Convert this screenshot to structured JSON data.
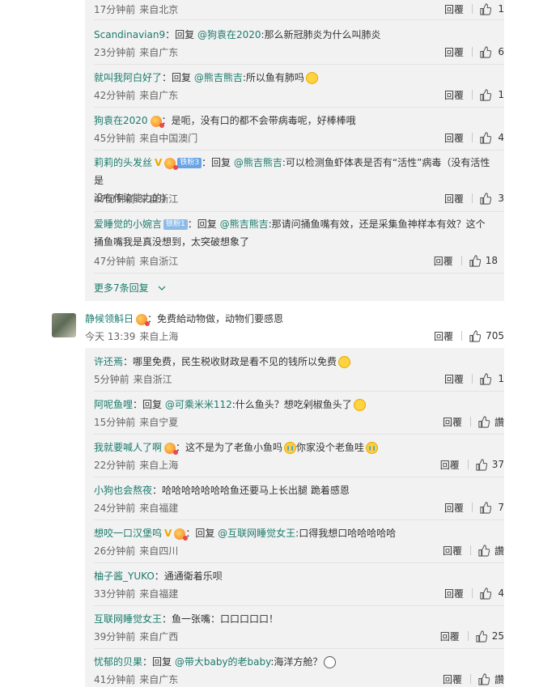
{
  "ui": {
    "reply_label": "回覆",
    "like_icon": "thumbs-up-icon",
    "more_replies": "更多7条回复"
  },
  "top_meta": {
    "time": "17分钟前",
    "location": "来自北京",
    "likes": "1"
  },
  "replies_a": [
    {
      "name": "Scandinavian9",
      "prefix": "：回复 ",
      "at": "@狗袁在2020",
      "text": ":那么新冠肺炎为什么叫肺炎",
      "time": "23分钟前",
      "location": "来自广东",
      "likes": "6"
    },
    {
      "name": "就叫我阿白好了",
      "prefix": "：回复 ",
      "at": "@熊吉熊吉",
      "text": ":所以鱼有肺吗",
      "time": "42分钟前",
      "location": "来自广东",
      "likes": "1"
    },
    {
      "name": "狗袁在2020",
      "prefix": "：",
      "at": "",
      "text": "是呃，没有口的都不会带病毒呢，好棒棒哦",
      "time": "45分钟前",
      "location": "来自中国澳门",
      "likes": "4"
    },
    {
      "name": "莉莉的头发丝",
      "fans_badge": "铁粉3",
      "prefix": "：回复 ",
      "at": "@熊吉熊吉",
      "text": ":可以检测鱼虾体表是否有“活性”病毒（没有活性是",
      "text2": "没有传染能力的）",
      "time": "47分钟前",
      "location": "来自浙江",
      "likes": "3"
    },
    {
      "name": "爱睡觉的小婉言",
      "fans_badge": "铁粉1",
      "prefix": "：回复 ",
      "at": "@熊吉熊吉",
      "text": ":那请问捅鱼嘴有效，还是采集鱼神样本有效？这个",
      "text2": "捅鱼嘴我是真没想到，太突破想象了",
      "time": "47分钟前",
      "location": "来自浙江",
      "likes": "18"
    }
  ],
  "main_comment": {
    "name": "静候领斛日",
    "text": "：免费給动物做，动物们要感恩",
    "time": "今天 13:39",
    "location": "来自上海",
    "likes": "705"
  },
  "replies_b": [
    {
      "name": "许还焉",
      "prefix": "：",
      "at": "",
      "text": "哪里免费，民生税收财政是看不见的钱所以免费",
      "time": "5分钟前",
      "location": "来自浙江",
      "likes": "1"
    },
    {
      "name": "阿呢鱼哩",
      "prefix": "：回复 ",
      "at": "@可乘米米112",
      "text": ":什么鱼头？想吃剁椒鱼头了",
      "time": "15分钟前",
      "location": "来自宁夏",
      "likes": "讚"
    },
    {
      "name": "我就要喊人了啊",
      "prefix": "：",
      "at": "",
      "text": "这不是为了老鱼小鱼吗",
      "text_b": "你家没个老鱼哇",
      "time": "22分钟前",
      "location": "来自上海",
      "likes": "37"
    },
    {
      "name": "小狗也会熬夜",
      "prefix": "：",
      "at": "",
      "text": "哈哈哈哈哈哈哈鱼还要马上长出腿 跪着感恩",
      "time": "24分钟前",
      "location": "来自福建",
      "likes": "7"
    },
    {
      "name": "想咬一口汉堡呜",
      "prefix": "：回复 ",
      "at": "@互联网睡觉女王",
      "text": ":口得我想口哈哈哈哈哈",
      "time": "26分钟前",
      "location": "来自四川",
      "likes": "讚"
    },
    {
      "name": "柚子酱_YUKO",
      "prefix": "：",
      "at": "",
      "text": "通通衛着乐呗",
      "time": "33分钟前",
      "location": "来自福建",
      "likes": "4"
    },
    {
      "name": "互联网睡觉女王",
      "prefix": "：",
      "at": "",
      "text": "鱼一张嘴：口口口口口！",
      "time": "39分钟前",
      "location": "来自广西",
      "likes": "25"
    },
    {
      "name": "忧郁的贝果",
      "prefix": "：回复 ",
      "at": "@带大baby的老baby",
      "text": ":海洋方舱？",
      "time": "41分钟前",
      "location": "来自广东",
      "likes": "讚"
    }
  ],
  "colors": {
    "name": "#1b7a6c",
    "panel": "#f2f2f2",
    "v_badge": "#f0a600",
    "fans_badge": "#6aa4e6"
  }
}
